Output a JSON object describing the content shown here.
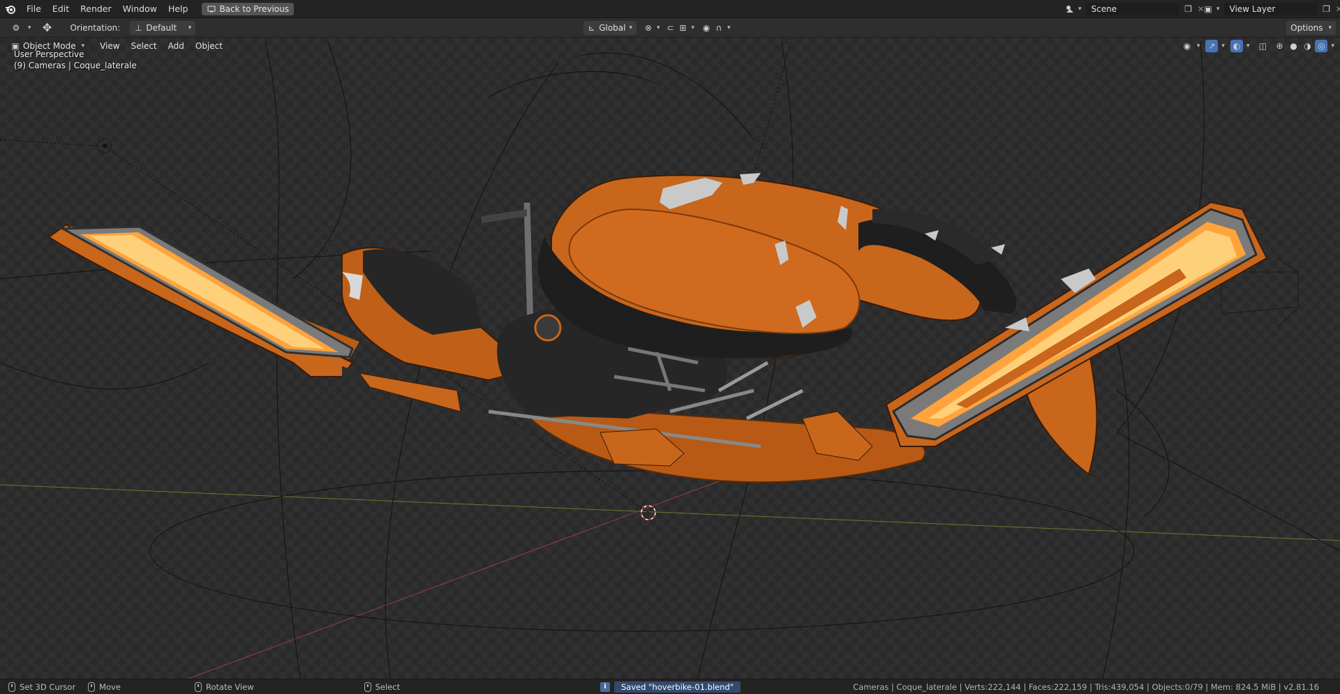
{
  "topbar": {
    "menu": [
      "File",
      "Edit",
      "Render",
      "Window",
      "Help"
    ],
    "back_button": "Back to Previous",
    "scene_label": "Scene",
    "view_layer_label": "View Layer"
  },
  "toolbar": {
    "orientation_label": "Orientation:",
    "orientation_value": "Default",
    "transform_space": "Global",
    "options_label": "Options"
  },
  "viewport": {
    "header": {
      "mode": "Object Mode",
      "menu": [
        "View",
        "Select",
        "Add",
        "Object"
      ]
    },
    "overlay": {
      "perspective": "User Perspective",
      "collection_info": "(9) Cameras | Coque_laterale"
    },
    "colors": {
      "orange": "#c8661c",
      "glow": "#ffb347",
      "dark": "#1b1b1b"
    }
  },
  "statusbar": {
    "hints": [
      "Set 3D Cursor",
      "Move",
      "Rotate View",
      "Select"
    ],
    "message": "Saved \"hoverbike-01.blend\"",
    "stats": "Cameras | Coque_laterale | Verts:222,144 | Faces:222,159 | Tris:439,054 | Objects:0/79 | Mem: 824.5 MiB | v2.81.16"
  }
}
